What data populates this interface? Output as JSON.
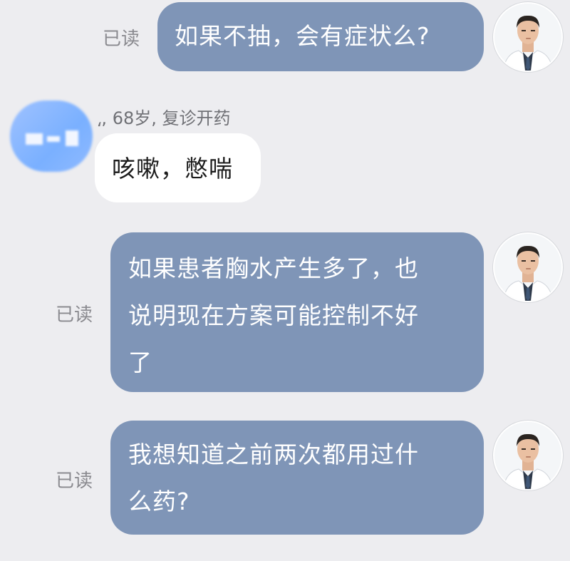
{
  "messages": [
    {
      "from": "doctor",
      "read_status": "已读",
      "lines": [
        "如果不抽，会有症状么?"
      ]
    },
    {
      "from": "patient",
      "sender_info": "⸲, 68岁, 复诊开药",
      "lines": [
        "咳嗽，憋喘"
      ]
    },
    {
      "from": "doctor",
      "read_status": "已读",
      "lines": [
        "如果患者胸水产生多了，也",
        "说明现在方案可能控制不好",
        "了"
      ]
    },
    {
      "from": "doctor",
      "read_status": "已读",
      "lines": [
        "我想知道之前两次都用过什",
        "么药?"
      ]
    }
  ],
  "colors": {
    "background": "#ededf0",
    "doctor_bubble": "#7f95b7",
    "patient_bubble": "#ffffff",
    "read_text": "#8a8a8f"
  },
  "icons": {
    "doctor_avatar": "doctor-photo-avatar",
    "patient_avatar": "blurred-patient-avatar"
  }
}
